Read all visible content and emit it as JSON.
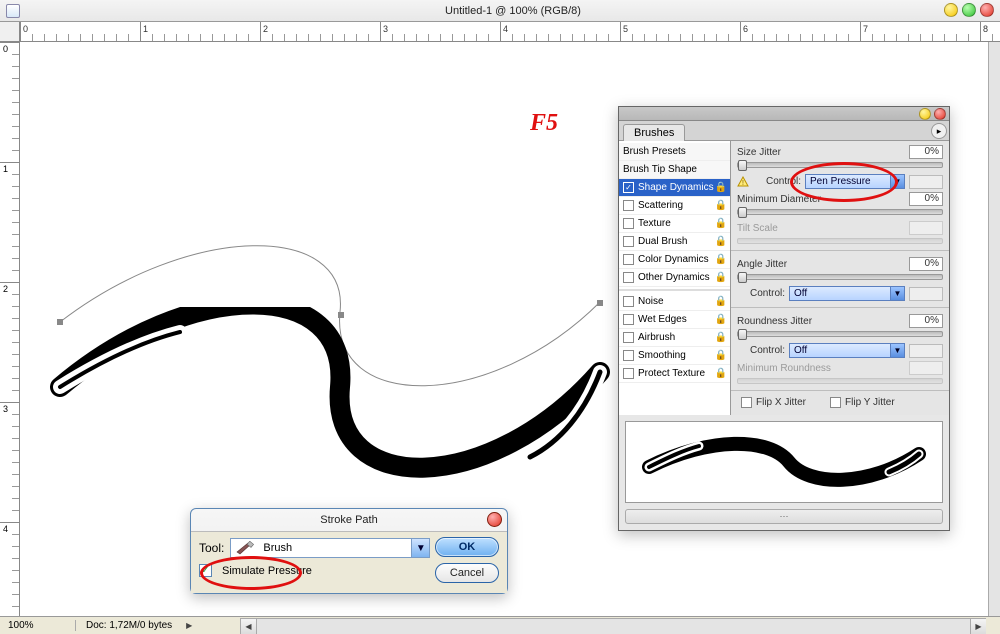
{
  "titlebar": {
    "title": "Untitled-1 @ 100% (RGB/8)"
  },
  "annotation": {
    "f5": "F5"
  },
  "ruler": {
    "h": [
      "0",
      "1",
      "2",
      "3",
      "4",
      "5",
      "6",
      "7",
      "8"
    ],
    "v": [
      "0",
      "1",
      "2",
      "3",
      "4"
    ]
  },
  "status": {
    "zoom": "100%",
    "doc": "Doc: 1,72M/0 bytes"
  },
  "stroke_dialog": {
    "title": "Stroke Path",
    "tool_label": "Tool:",
    "tool_value": "Brush",
    "simulate_label": "Simulate Pressure",
    "simulate_checked": true,
    "ok": "OK",
    "cancel": "Cancel"
  },
  "brushes_panel": {
    "tab": "Brushes",
    "presets": "Brush Presets",
    "tipshape": "Brush Tip Shape",
    "items": [
      {
        "label": "Shape Dynamics",
        "checked": true,
        "active": true,
        "locked": true
      },
      {
        "label": "Scattering",
        "checked": false,
        "locked": true
      },
      {
        "label": "Texture",
        "checked": false,
        "locked": true
      },
      {
        "label": "Dual Brush",
        "checked": false,
        "locked": true
      },
      {
        "label": "Color Dynamics",
        "checked": false,
        "locked": true
      },
      {
        "label": "Other Dynamics",
        "checked": false,
        "locked": true
      },
      {
        "label": "Noise",
        "checked": false,
        "locked": true,
        "sep": true
      },
      {
        "label": "Wet Edges",
        "checked": false,
        "locked": true
      },
      {
        "label": "Airbrush",
        "checked": false,
        "locked": true
      },
      {
        "label": "Smoothing",
        "checked": false,
        "locked": true
      },
      {
        "label": "Protect Texture",
        "checked": false,
        "locked": true
      }
    ],
    "right": {
      "size_jitter": {
        "label": "Size Jitter",
        "value": "0%"
      },
      "control1": {
        "label": "Control:",
        "value": "Pen Pressure"
      },
      "min_diam": {
        "label": "Minimum Diameter",
        "value": "0%"
      },
      "tilt_scale": {
        "label": "Tilt Scale",
        "value": ""
      },
      "angle_jitter": {
        "label": "Angle Jitter",
        "value": "0%"
      },
      "control2": {
        "label": "Control:",
        "value": "Off"
      },
      "round_jitter": {
        "label": "Roundness Jitter",
        "value": "0%"
      },
      "control3": {
        "label": "Control:",
        "value": "Off"
      },
      "min_round": {
        "label": "Minimum Roundness",
        "value": ""
      },
      "flipx": "Flip X Jitter",
      "flipy": "Flip Y Jitter"
    }
  }
}
